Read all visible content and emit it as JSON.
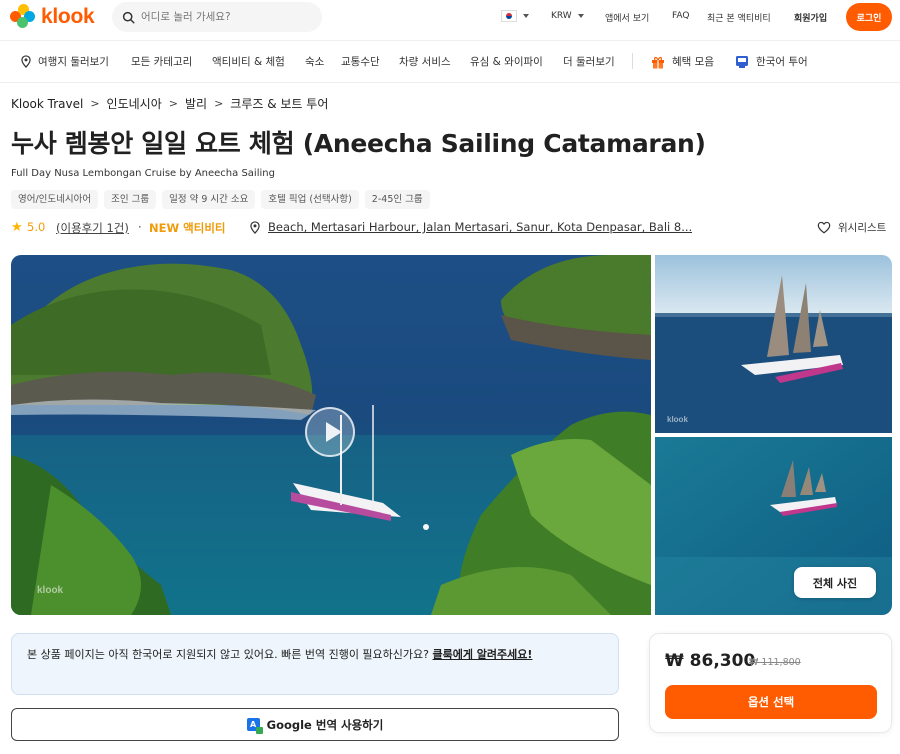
{
  "header": {
    "logo_text": "klook",
    "search_placeholder": "어디로 놀러 가세요?",
    "currency": "KRW",
    "app_link": "앱에서 보기",
    "faq": "FAQ",
    "recent": "최근 본 액티비티",
    "signup": "회원가입",
    "login": "로그인",
    "brand_color": "#ff5b00"
  },
  "nav": {
    "items": [
      "여행지 둘러보기",
      "모든 카테고리",
      "액티비티 & 체험",
      "숙소",
      "교통수단",
      "차량 서비스",
      "유심 & 와이파이",
      "더 둘러보기",
      "혜택 모음",
      "한국어 투어"
    ],
    "icons": [
      "location-pin-icon",
      "gift-icon",
      "korea-tour-icon"
    ]
  },
  "breadcrumb": [
    "Klook Travel",
    "인도네시아",
    "발리",
    "크루즈 & 보트 투어"
  ],
  "product": {
    "title": "누사 렘봉안 일일 요트 체험 (Aneecha Sailing Catamaran)",
    "subtitle": "Full Day Nusa Lembongan Cruise by Aneecha Sailing",
    "tags": [
      "영어/인도네시아어",
      "조인 그룹",
      "일정 약 9 시간 소요",
      "호텔 픽업 (선택사항)",
      "2-45인 그룹"
    ],
    "rating": "5.0",
    "reviews": "(이용후기 1건)",
    "separator": "·",
    "badge": "NEW 액티비티",
    "location": "Beach, Mertasari Harbour, Jalan Mertasari, Sanur, Kota Denpasar, Bali 8...",
    "wishlist": "위시리스트"
  },
  "gallery": {
    "all_photos": "전체 사진",
    "watermark": "klook"
  },
  "notice": {
    "text": "본 상품 페이지는 아직 한국어로 지원되지 않고 있어요. 빠른 번역 진행이 필요하신가요? ",
    "link": "클룩에게 알려주세요!"
  },
  "google_translate": {
    "label": "Google 번역 사용하기"
  },
  "price": {
    "current": "₩ 86,300",
    "original": "₩ 111,800",
    "button": "옵션 선택"
  }
}
